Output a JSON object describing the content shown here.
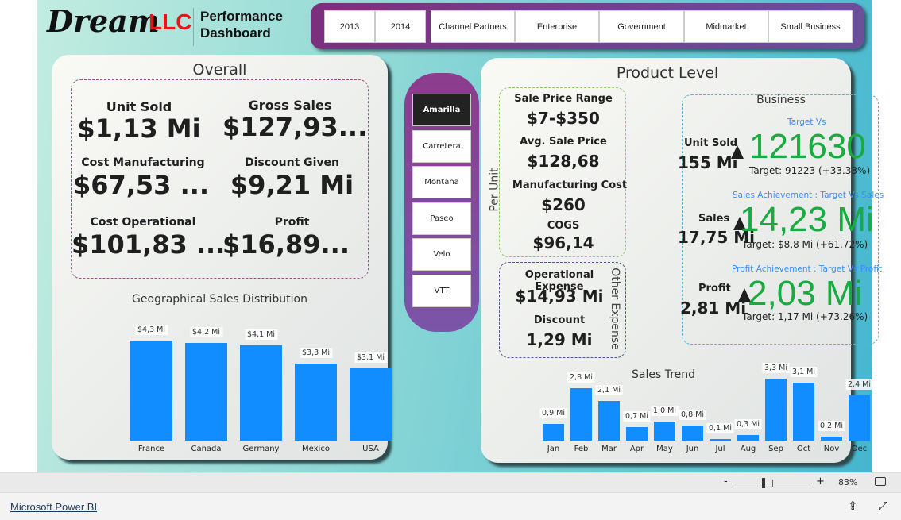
{
  "logo": {
    "dream": "Dream",
    "llc": "LLC",
    "title_line1": "Performance",
    "title_line2": "Dashboard"
  },
  "filters": [
    "2013",
    "2014",
    "Channel Partners",
    "Enterprise",
    "Government",
    "Midmarket",
    "Small Business"
  ],
  "overall": {
    "title": "Overall",
    "kpis": [
      {
        "label": "Unit Sold",
        "value": "$1,13 Mi"
      },
      {
        "label": "Gross Sales",
        "value": "$127,93..."
      },
      {
        "label": "Cost Manufacturing",
        "value": "$67,53 ..."
      },
      {
        "label": "Discount Given",
        "value": "$9,21 Mi"
      },
      {
        "label": "Cost Operational",
        "value": "$101,83 ..."
      },
      {
        "label": "Profit",
        "value": "$16,89..."
      }
    ]
  },
  "products": {
    "items": [
      "Amarilla",
      "Carretera",
      "Montana",
      "Paseo",
      "Velo",
      "VTT"
    ],
    "selected": "Amarilla"
  },
  "product_level": {
    "title": "Product Level",
    "per_unit": {
      "side_label": "Per Unit",
      "items": [
        {
          "label": "Sale Price Range",
          "value": "$7-$350"
        },
        {
          "label": "Avg. Sale Price",
          "value": "$128,68"
        },
        {
          "label": "Manufacturing Cost",
          "value": "$260"
        },
        {
          "label": "COGS",
          "value": "$96,14"
        }
      ]
    },
    "other_expense": {
      "side_label": "Other Expense",
      "items": [
        {
          "label": "Operational Expense",
          "value": "$14,93 Mi"
        },
        {
          "label": "Discount",
          "value": "1,29 Mi"
        }
      ]
    },
    "business": {
      "title": "Business",
      "rows": [
        {
          "caption": "Target Vs",
          "label": "Unit Sold",
          "actual": "155 Mi",
          "value": "121630",
          "target": "Target: 91223 (+33.33%)"
        },
        {
          "caption": "Sales Achievement : Target Vs Sales",
          "label": "Sales",
          "actual": "17,75 Mi",
          "value": "14,23 Mi",
          "target": "Target: $8,8 Mi (+61.72%)"
        },
        {
          "caption": "Profit Achievement : Target Vs Profit",
          "label": "Profit",
          "actual": "2,81 Mi",
          "value": "2,03 Mi",
          "target": "Target: 1,17 Mi (+73.26%)"
        }
      ],
      "indicator_color": "#1aab40"
    }
  },
  "chart_data": [
    {
      "type": "bar",
      "title": "Geographical Sales Distribution",
      "categories": [
        "France",
        "Canada",
        "Germany",
        "Mexico",
        "USA"
      ],
      "values": [
        4.3,
        4.2,
        4.1,
        3.3,
        3.1
      ],
      "data_labels": [
        "$4,3 Mi",
        "$4,2 Mi",
        "$4,1 Mi",
        "$3,3 Mi",
        "$3,1 Mi"
      ],
      "color": "#118dff",
      "grid": false
    },
    {
      "type": "bar",
      "title": "Sales Trend",
      "categories": [
        "Jan",
        "Feb",
        "Mar",
        "Apr",
        "May",
        "Jun",
        "Jul",
        "Aug",
        "Sep",
        "Oct",
        "Nov",
        "Dec"
      ],
      "values": [
        0.9,
        2.8,
        2.1,
        0.7,
        1.0,
        0.8,
        0.1,
        0.3,
        3.3,
        3.1,
        0.2,
        2.4
      ],
      "data_labels": [
        "0,9 Mi",
        "2,8 Mi",
        "2,1 Mi",
        "0,7 Mi",
        "1,0 Mi",
        "0,8 Mi",
        "0,1 Mi",
        "0,3 Mi",
        "3,3 Mi",
        "3,1 Mi",
        "0,2 Mi",
        "2,4 Mi"
      ],
      "color": "#118dff",
      "grid": false
    }
  ],
  "statusbar": {
    "zoom_minus": "-",
    "zoom_plus": "+",
    "zoom": "83%",
    "zoom_level": 83
  },
  "footer": {
    "link": "Microsoft Power BI"
  }
}
